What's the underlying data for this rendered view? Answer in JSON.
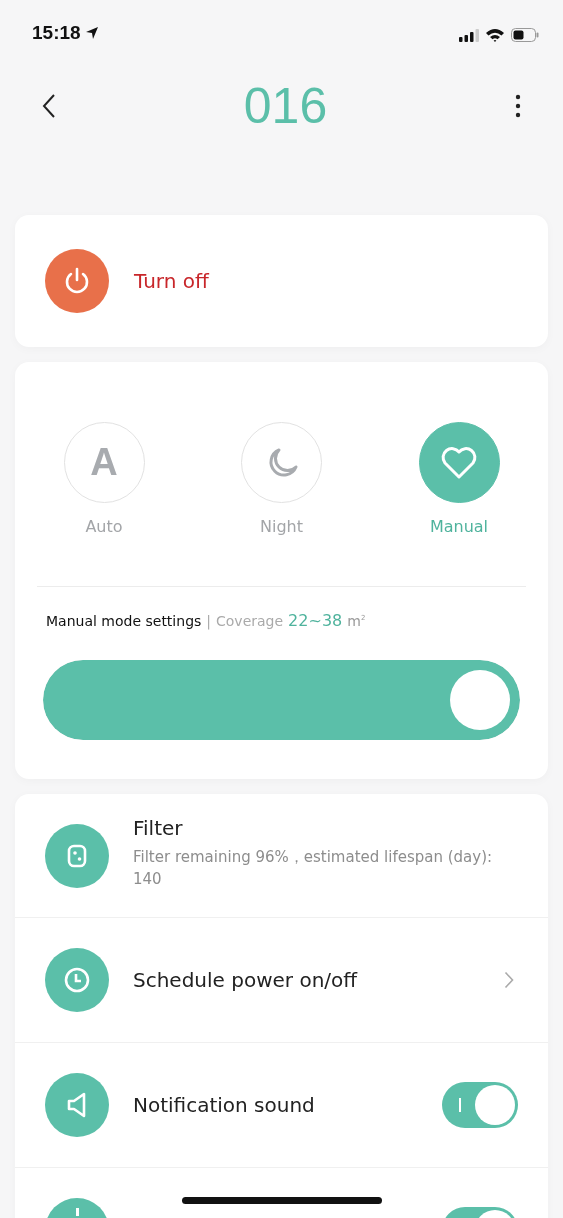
{
  "status_bar": {
    "time": "15:18"
  },
  "header": {
    "title": "016"
  },
  "power": {
    "label": "Turn off",
    "on": true
  },
  "modes": [
    {
      "kind": "auto",
      "glyph": "A",
      "label": "Auto",
      "selected": false
    },
    {
      "kind": "night",
      "label": "Night",
      "selected": false
    },
    {
      "kind": "manual",
      "label": "Manual",
      "selected": true
    }
  ],
  "settings": {
    "title": "Manual mode settings",
    "separator": "|",
    "coverage_label": "Coverage",
    "coverage_value": "22~38",
    "coverage_unit": "m$^{2}$",
    "level": 1
  },
  "rows": [
    {
      "kind": "info",
      "title": "Filter",
      "subtitle": "Filter remaining 96%，estimated lifespan (day): 140"
    },
    {
      "kind": "link",
      "title": "Schedule power on/off"
    },
    {
      "kind": "toggle",
      "title": "Notification sound",
      "on": true
    },
    {
      "kind": "toggle",
      "on": true
    }
  ]
}
